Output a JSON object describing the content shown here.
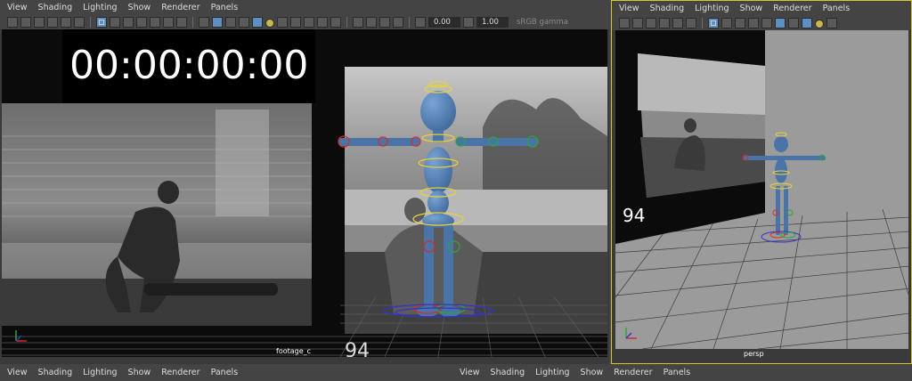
{
  "menus": [
    "View",
    "Shading",
    "Lighting",
    "Show",
    "Renderer",
    "Panels"
  ],
  "toolbar": {
    "exposure": "0.00",
    "gamma": "1.00",
    "color_space": "sRGB gamma"
  },
  "left_viewport": {
    "timecode": "00:00:00:00",
    "camera_label": "footage_c",
    "frame_text": "94"
  },
  "right_viewport": {
    "camera_label": "persp",
    "frame_text": "94"
  },
  "colors": {
    "panel_bg": "#444444",
    "active_border": "#d6c433",
    "rig_blue": "#4a73a8",
    "ctrl_yellow": "#e6d33a",
    "ctrl_red": "#d0302a",
    "ctrl_green": "#2ea43a",
    "ctrl_blue": "#3434c8"
  }
}
